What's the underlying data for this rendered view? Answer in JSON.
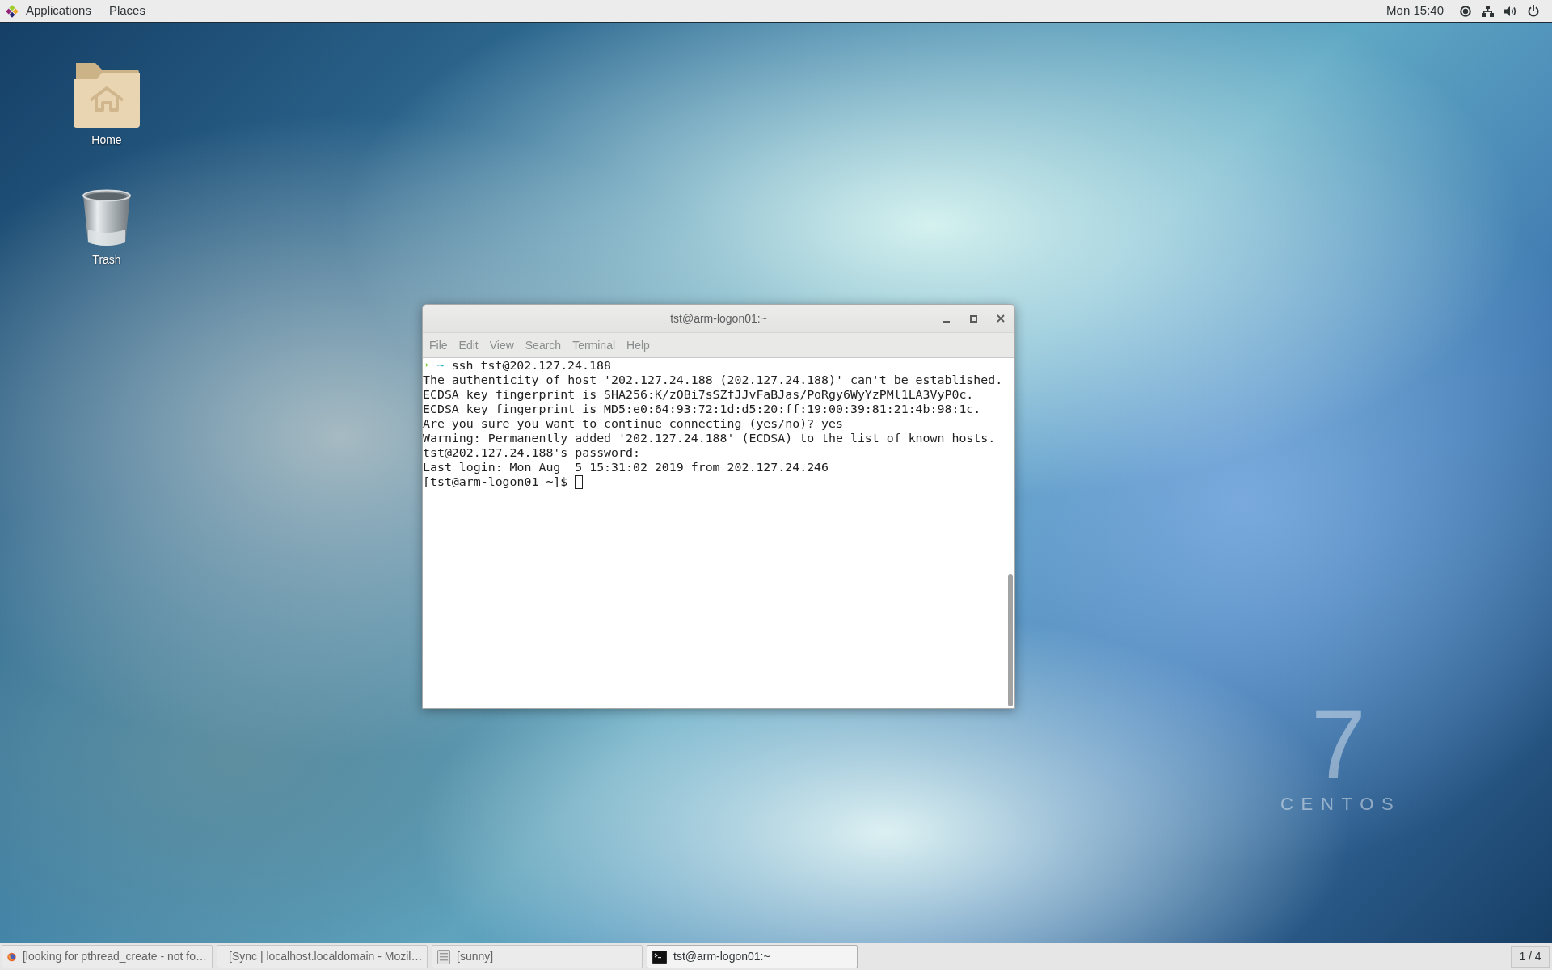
{
  "top_bar": {
    "applications": "Applications",
    "places": "Places",
    "clock": "Mon 15:40"
  },
  "desktop_icons": [
    {
      "kind": "folder",
      "label": "Home"
    },
    {
      "kind": "trash",
      "label": "Trash"
    }
  ],
  "terminal_window": {
    "title": "tst@arm-logon01:~",
    "menu": [
      "File",
      "Edit",
      "View",
      "Search",
      "Terminal",
      "Help"
    ],
    "lines": [
      {
        "kind": "zsh_prompt",
        "arrow": "➜",
        "dir": "~",
        "command": "ssh tst@202.127.24.188"
      },
      {
        "kind": "output",
        "text": "The authenticity of host '202.127.24.188 (202.127.24.188)' can't be established."
      },
      {
        "kind": "output",
        "text": "ECDSA key fingerprint is SHA256:K/zOBi7sSZfJJvFaBJas/PoRgy6WyYzPMl1LA3VyP0c."
      },
      {
        "kind": "output",
        "text": "ECDSA key fingerprint is MD5:e0:64:93:72:1d:d5:20:ff:19:00:39:81:21:4b:98:1c."
      },
      {
        "kind": "output",
        "text": "Are you sure you want to continue connecting (yes/no)? yes"
      },
      {
        "kind": "output",
        "text": "Warning: Permanently added '202.127.24.188' (ECDSA) to the list of known hosts."
      },
      {
        "kind": "output",
        "text": "tst@202.127.24.188's password:"
      },
      {
        "kind": "output",
        "text": "Last login: Mon Aug  5 15:31:02 2019 from 202.127.24.246"
      },
      {
        "kind": "shell_prompt",
        "text": "[tst@arm-logon01 ~]$",
        "cursor": true
      }
    ]
  },
  "wallpaper": {
    "version": "7",
    "brand": "CENTOS"
  },
  "taskbar": {
    "items": [
      {
        "kind": "browser",
        "label": "[looking for pthread_create - not fo…",
        "selected": false
      },
      {
        "kind": "browser",
        "label": "[Sync | localhost.localdomain - Mozil…",
        "selected": false
      },
      {
        "kind": "file",
        "label": "[sunny]",
        "selected": false
      },
      {
        "kind": "terminal",
        "label": "tst@arm-logon01:~",
        "selected": true
      }
    ],
    "workspace": "1 / 4"
  }
}
